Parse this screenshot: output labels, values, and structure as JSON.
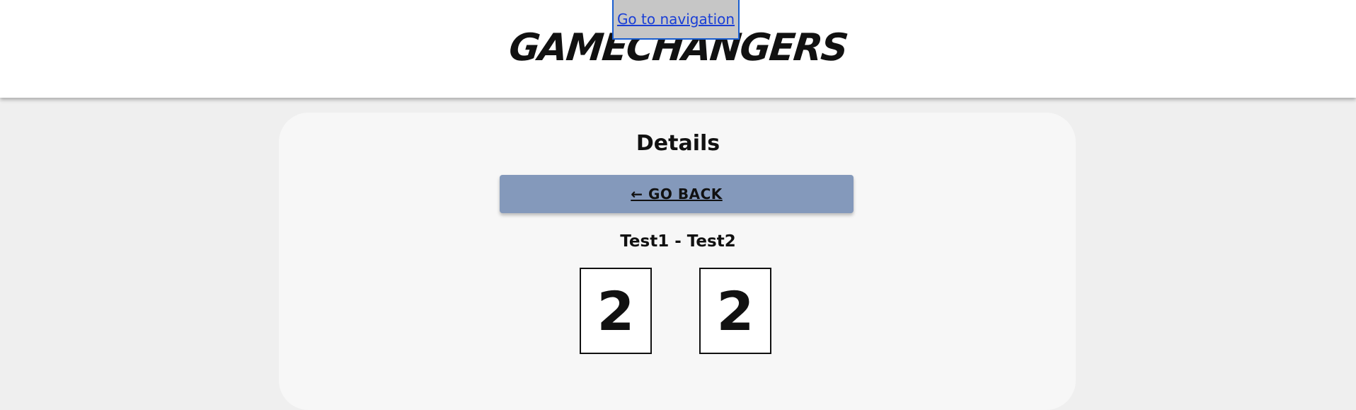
{
  "skip_link": {
    "label": "Go to navigation"
  },
  "header": {
    "logo_text": "GAMECHANGERS"
  },
  "main": {
    "title": "Details",
    "back_button_label": "← GO BACK",
    "match_title": "Test1 - Test2",
    "scores": {
      "home": "2",
      "away": "2"
    }
  },
  "colors": {
    "page_background": "#efefef",
    "card_background": "#f7f7f7",
    "back_button": "#8499bb",
    "skip_link_background": "#c6c6c6",
    "skip_link_text": "#1a3fd6"
  }
}
